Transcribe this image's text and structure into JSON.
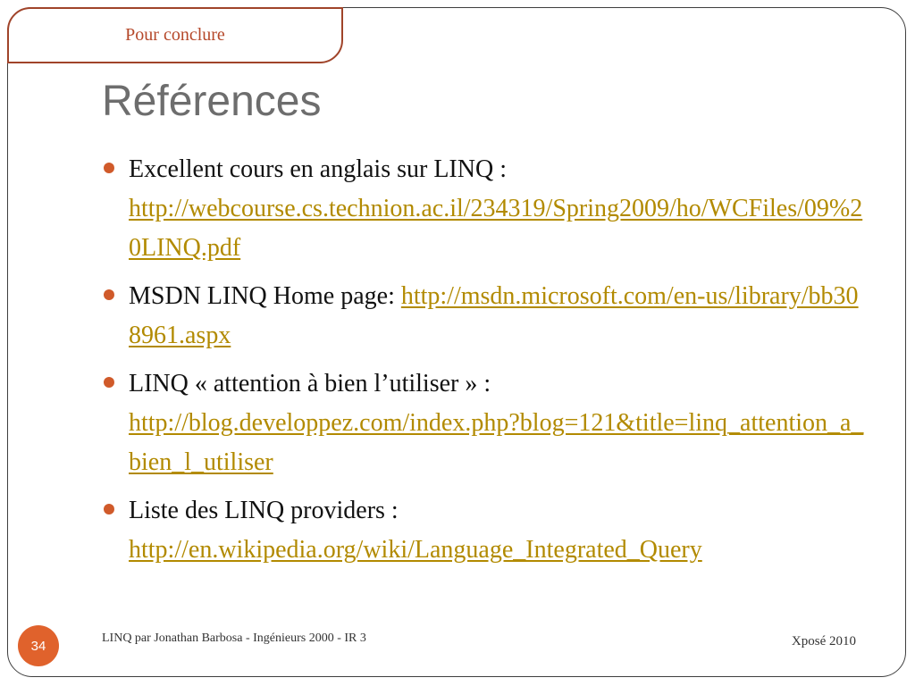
{
  "section_tab": "Pour conclure",
  "title": "Références",
  "items": [
    {
      "text": "Excellent cours en anglais sur LINQ : ",
      "link": "http://webcourse.cs.technion.ac.il/234319/Spring2009/ho/WCFiles/09%20LINQ.pdf"
    },
    {
      "text": "MSDN LINQ Home page: ",
      "link": "http://msdn.microsoft.com/en-us/library/bb308961.aspx"
    },
    {
      "text": "LINQ « attention à bien l’utiliser » : ",
      "link": "http://blog.developpez.com/index.php?blog=121&title=linq_attention_a_bien_l_utiliser"
    },
    {
      "text": "Liste des LINQ providers : ",
      "link": "http://en.wikipedia.org/wiki/Language_Integrated_Query"
    }
  ],
  "footer": {
    "page_number": "34",
    "left_text": "LINQ par Jonathan Barbosa - Ingénieurs 2000 - IR 3",
    "right_text": "Xposé 2010"
  },
  "colors": {
    "accent": "#e0622c",
    "link": "#b28a00",
    "tab_border": "#a0442a",
    "title": "#6d6d6d"
  }
}
